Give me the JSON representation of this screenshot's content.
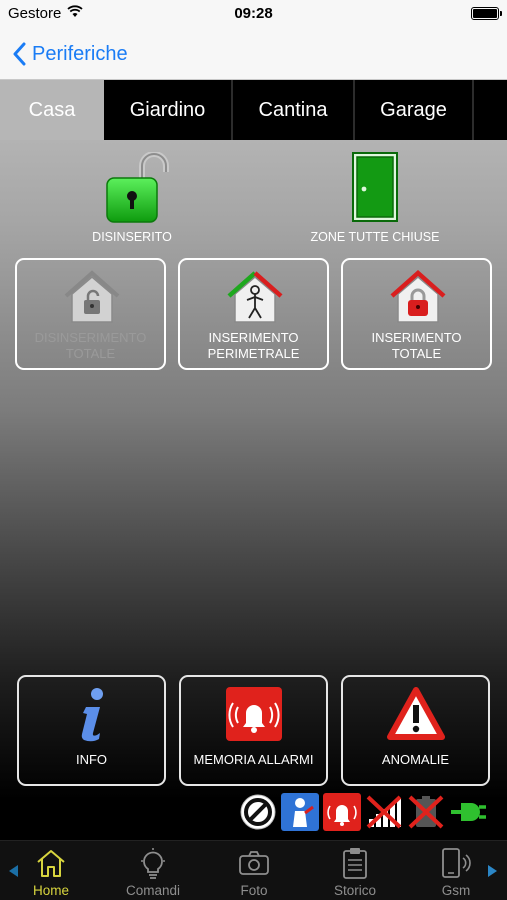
{
  "status_bar": {
    "carrier": "Gestore",
    "time": "09:28"
  },
  "nav": {
    "back_label": "Periferiche"
  },
  "tabs": [
    {
      "label": "Casa"
    },
    {
      "label": "Giardino"
    },
    {
      "label": "Cantina"
    },
    {
      "label": "Garage"
    }
  ],
  "system_status": {
    "arm_state": "DISINSERITO",
    "zones_state": "ZONE TUTTE CHIUSE"
  },
  "modes": {
    "total_disarm": {
      "line1": "DISINSERIMENTO",
      "line2": "TOTALE"
    },
    "perimeter_arm": {
      "line1": "INSERIMENTO",
      "line2": "PERIMETRALE"
    },
    "total_arm": {
      "line1": "INSERIMENTO",
      "line2": "TOTALE"
    }
  },
  "actions": {
    "info": "INFO",
    "alarm_memory": "MEMORIA ALLARMI",
    "anomalies": "ANOMALIE"
  },
  "indicator_icons": [
    "no-entry-icon",
    "technician-icon",
    "alarm-bell-icon",
    "signal-off-icon",
    "battery-off-icon",
    "power-plug-icon"
  ],
  "tab_bar": [
    {
      "label": "Home",
      "icon": "home-icon",
      "active": true
    },
    {
      "label": "Comandi",
      "icon": "lightbulb-icon"
    },
    {
      "label": "Foto",
      "icon": "camera-icon"
    },
    {
      "label": "Storico",
      "icon": "clipboard-icon"
    },
    {
      "label": "Gsm",
      "icon": "phone-icon"
    }
  ],
  "colors": {
    "ios_blue": "#1a7cf5",
    "active_tab": "#d8d53e",
    "alarm_red": "#e0221c",
    "lock_green": "#22c322"
  }
}
